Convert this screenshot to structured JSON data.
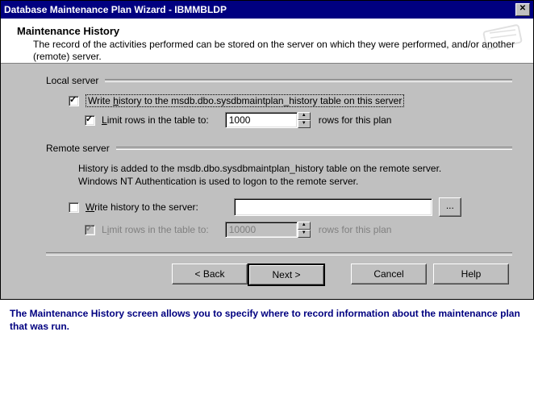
{
  "window": {
    "title": "Database Maintenance Plan Wizard - IBMMBLDP"
  },
  "header": {
    "title": "Maintenance History",
    "description": "The record of the activities performed can be stored on the server on which they were performed, and/or another (remote) server."
  },
  "local": {
    "group_label": "Local server",
    "write_history_label_pre": "Write ",
    "write_history_label_u": "h",
    "write_history_label_post": "istory to the msdb.dbo.sysdbmaintplan_history table on this server",
    "write_history_checked": true,
    "limit_label_pre": "",
    "limit_label_u": "L",
    "limit_label_post": "imit rows in the table to:",
    "limit_checked": true,
    "limit_value": "1000",
    "limit_suffix": "rows for this plan"
  },
  "remote": {
    "group_label": "Remote server",
    "info_line1": "History is added to the msdb.dbo.sysdbmaintplan_history table on the remote server.",
    "info_line2": "Windows NT Authentication is used to logon to the remote server.",
    "write_label_u": "W",
    "write_label_post": "rite history to the server:",
    "write_checked": false,
    "server_value": "",
    "browse_label": "...",
    "limit_label_pre": "L",
    "limit_label_u": "i",
    "limit_label_post": "mit rows in the table to:",
    "limit_checked": true,
    "limit_value": "10000",
    "limit_suffix": "rows for this plan"
  },
  "buttons": {
    "back": "< Back",
    "next": "Next >",
    "cancel": "Cancel",
    "help": "Help"
  },
  "caption": "The Maintenance History screen allows you to specify where to record information about the maintenance plan that was run."
}
